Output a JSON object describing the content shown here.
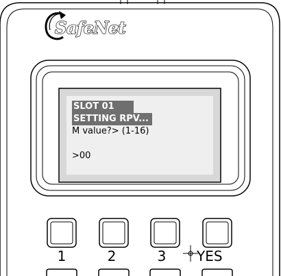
{
  "device": {
    "brand": "SafeNet"
  },
  "lcd": {
    "line1": "SLOT 01",
    "line2": "SETTING RPV...",
    "line3": "M value?> (1-16)",
    "line5": ">00"
  },
  "keypad": {
    "keys": [
      {
        "label": "1"
      },
      {
        "label": "2"
      },
      {
        "label": "3"
      },
      {
        "label": "YES"
      }
    ]
  }
}
